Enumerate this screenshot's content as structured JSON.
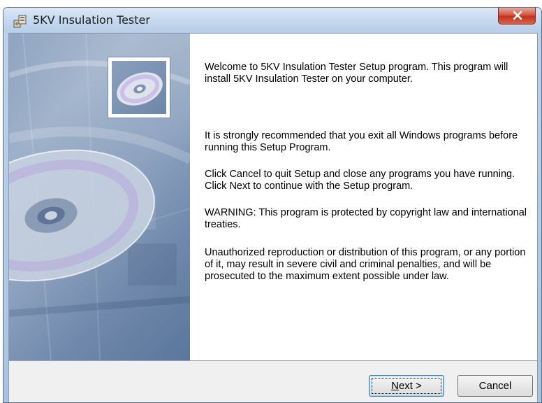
{
  "window": {
    "title": "5KV Insulation Tester",
    "app_icon": "installer-icon",
    "close_icon": "close-icon"
  },
  "side_panel": {
    "image": "cd-disc-artwork",
    "thumbnail": "cd-icon"
  },
  "content": {
    "paragraphs": [
      "Welcome to 5KV Insulation Tester Setup program. This program will install 5KV Insulation Tester on your computer.",
      "It is strongly recommended that you exit all Windows programs before running this Setup Program.",
      "Click Cancel to quit Setup and close any programs you have running.  Click Next to continue with the Setup program.",
      "WARNING: This program is protected by copyright law and international treaties.",
      "Unauthorized reproduction or distribution of this program, or any portion of it, may result in severe civil and criminal penalties, and will be prosecuted to the maximum extent possible under law."
    ]
  },
  "buttons": {
    "next_prefix": "",
    "next_mnemonic": "N",
    "next_rest": "ext >",
    "cancel": "Cancel"
  },
  "colors": {
    "close_button": "#c2321d",
    "titlebar": "#c6d9ee",
    "side_panel": "#7d95b6"
  }
}
